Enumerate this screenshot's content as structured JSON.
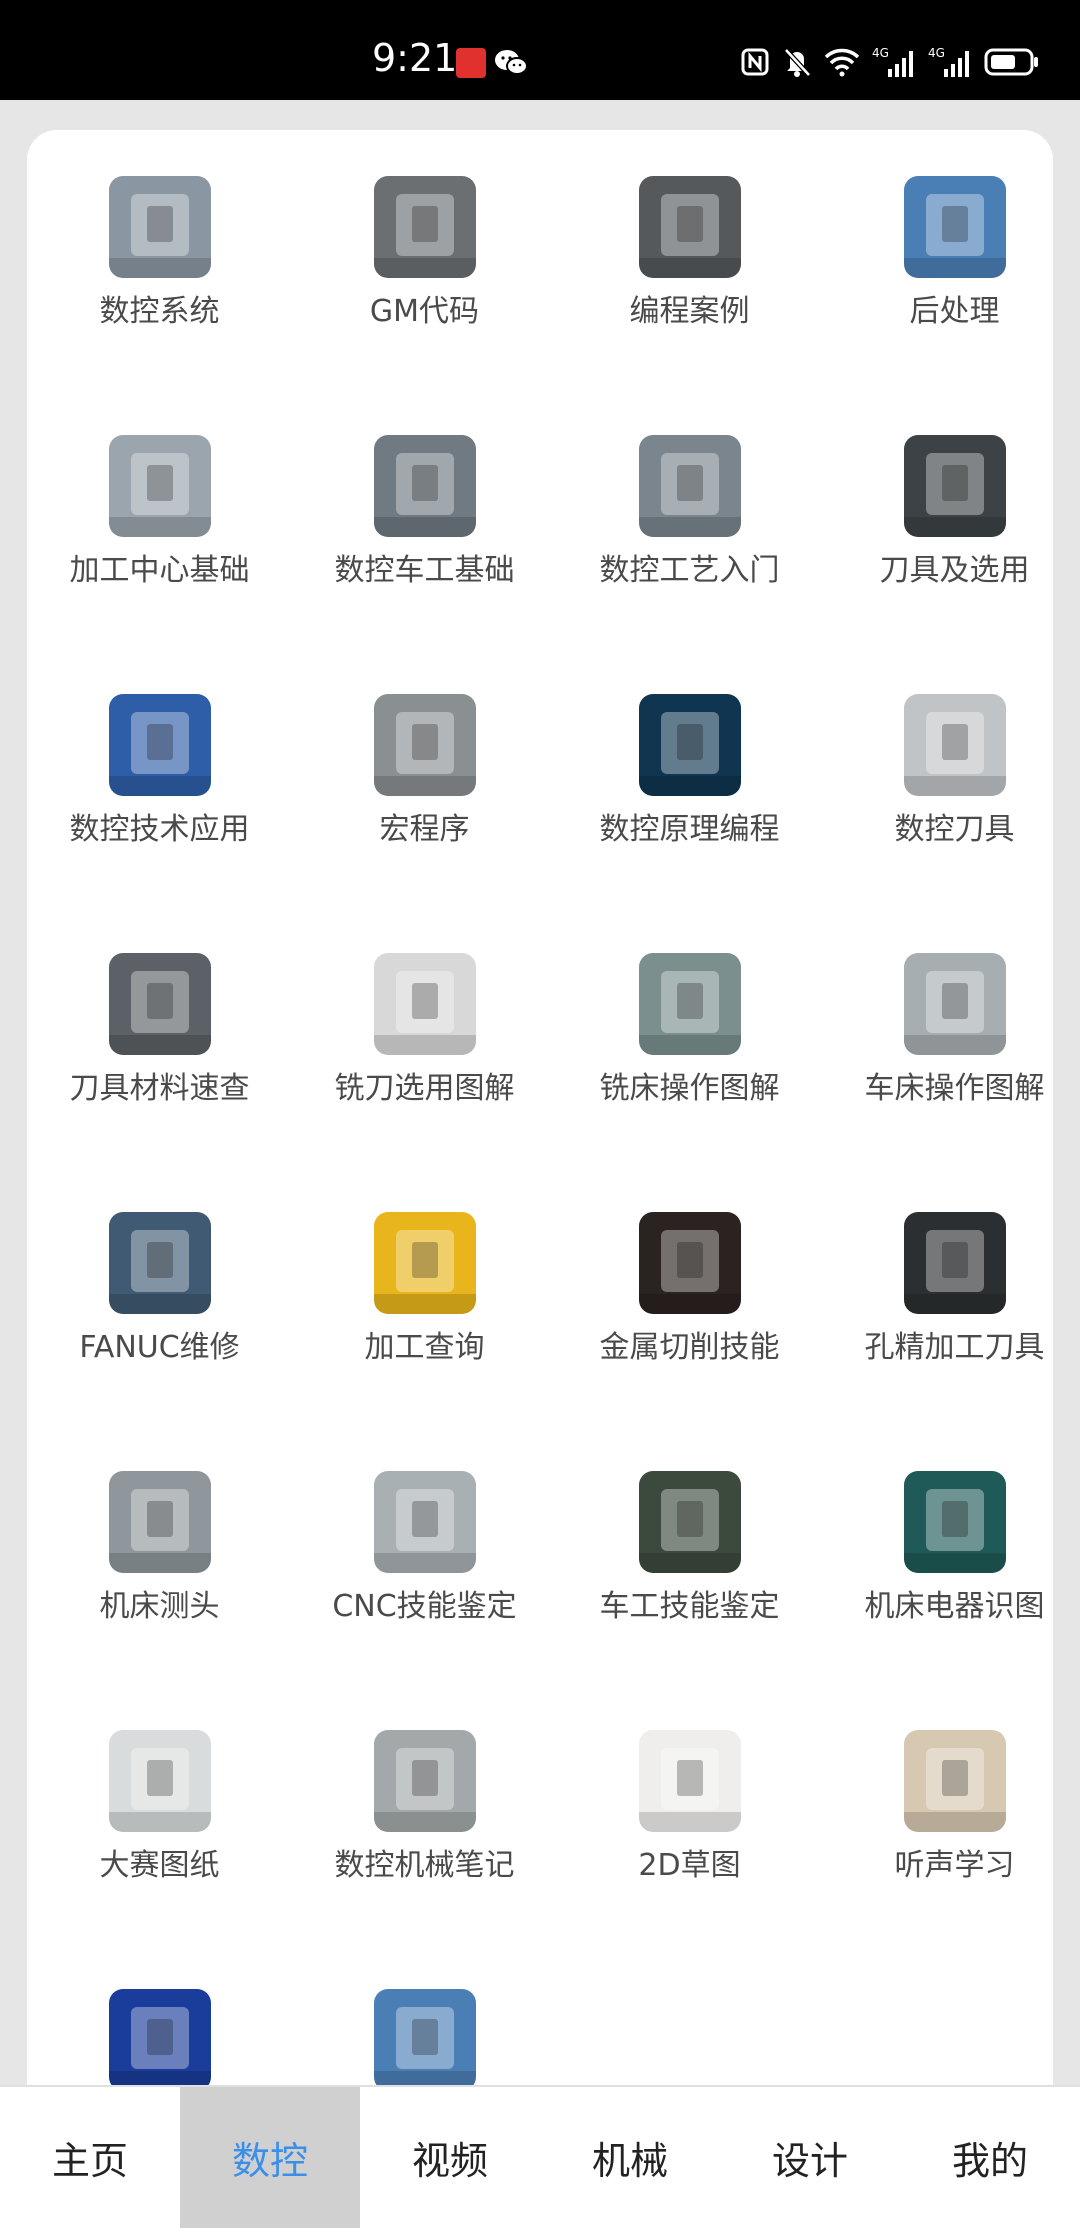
{
  "status_bar": {
    "time": "9:21",
    "app_badge": "小红书",
    "icons": [
      "nfc-icon",
      "mute-bell-icon",
      "wifi-icon",
      "signal-4g-icon",
      "signal-4g-icon",
      "battery-icon"
    ],
    "net_labels": [
      "4G",
      "4G"
    ]
  },
  "grid": {
    "items": [
      {
        "label": "数控系统",
        "icon": "cnc-machine-image",
        "color": "#8a97a3"
      },
      {
        "label": "GM代码",
        "icon": "code-screen-image",
        "color": "#6b6f72"
      },
      {
        "label": "编程案例",
        "icon": "computer-machine-image",
        "color": "#55595c"
      },
      {
        "label": "后处理",
        "icon": "workpiece-image",
        "color": "#4a7fb5"
      },
      {
        "label": "加工中心基础",
        "icon": "machining-center-image",
        "color": "#9aa5ad"
      },
      {
        "label": "数控车工基础",
        "icon": "lathe-image",
        "color": "#6f7a82"
      },
      {
        "label": "数控工艺入门",
        "icon": "mill-spindle-image",
        "color": "#7a858d"
      },
      {
        "label": "刀具及选用",
        "icon": "drill-bit-image",
        "color": "#3d4246"
      },
      {
        "label": "数控技术应用",
        "icon": "cnc-application-image",
        "color": "#2e5ea8"
      },
      {
        "label": "宏程序",
        "icon": "chuck-image",
        "color": "#8a8f92"
      },
      {
        "label": "数控原理编程",
        "icon": "blueprint-image",
        "color": "#0f3550"
      },
      {
        "label": "数控刀具",
        "icon": "end-mills-image",
        "color": "#c0c4c6"
      },
      {
        "label": "刀具材料速查",
        "icon": "drill-bits-image",
        "color": "#5b6166"
      },
      {
        "label": "铣刀选用图解",
        "icon": "cutter-chart-image",
        "color": "#d8d8d8"
      },
      {
        "label": "铣床操作图解",
        "icon": "milling-machine-image",
        "color": "#7b8f8f"
      },
      {
        "label": "车床操作图解",
        "icon": "lathe-panel-image",
        "color": "#a7aeb2"
      },
      {
        "label": "FANUC维修",
        "icon": "technician-image",
        "color": "#3f5a72"
      },
      {
        "label": "加工查询",
        "icon": "query-banner-image",
        "color": "#e8b51c"
      },
      {
        "label": "金属切削技能",
        "icon": "sparks-image",
        "color": "#2b2320"
      },
      {
        "label": "孔精加工刀具",
        "icon": "hole-tool-image",
        "color": "#2c2f31"
      },
      {
        "label": "机床测头",
        "icon": "probe-image",
        "color": "#8f979c"
      },
      {
        "label": "CNC技能鉴定",
        "icon": "certificate-image",
        "color": "#a8b0b4"
      },
      {
        "label": "车工技能鉴定",
        "icon": "workers-image",
        "color": "#3c4a3e"
      },
      {
        "label": "机床电器识图",
        "icon": "electrical-image",
        "color": "#1f5a58"
      },
      {
        "label": "大赛图纸",
        "icon": "drawing-image",
        "color": "#d9dcdc"
      },
      {
        "label": "数控机械笔记",
        "icon": "notebook-image",
        "color": "#a3a8aa"
      },
      {
        "label": "2D草图",
        "icon": "sketch-image",
        "color": "#efeeec"
      },
      {
        "label": "听声学习",
        "icon": "listening-image",
        "color": "#d7c8b2"
      },
      {
        "label": "",
        "icon": "dashboard-image",
        "color": "#1a3c9a"
      },
      {
        "label": "",
        "icon": "machine-photo-image",
        "color": "#4a7fb5"
      }
    ]
  },
  "bottom_nav": {
    "items": [
      {
        "label": "主页",
        "active": false
      },
      {
        "label": "数控",
        "active": true
      },
      {
        "label": "视频",
        "active": false
      },
      {
        "label": "机械",
        "active": false
      },
      {
        "label": "设计",
        "active": false
      },
      {
        "label": "我的",
        "active": false
      }
    ],
    "active_color": "#3b8fe8"
  }
}
